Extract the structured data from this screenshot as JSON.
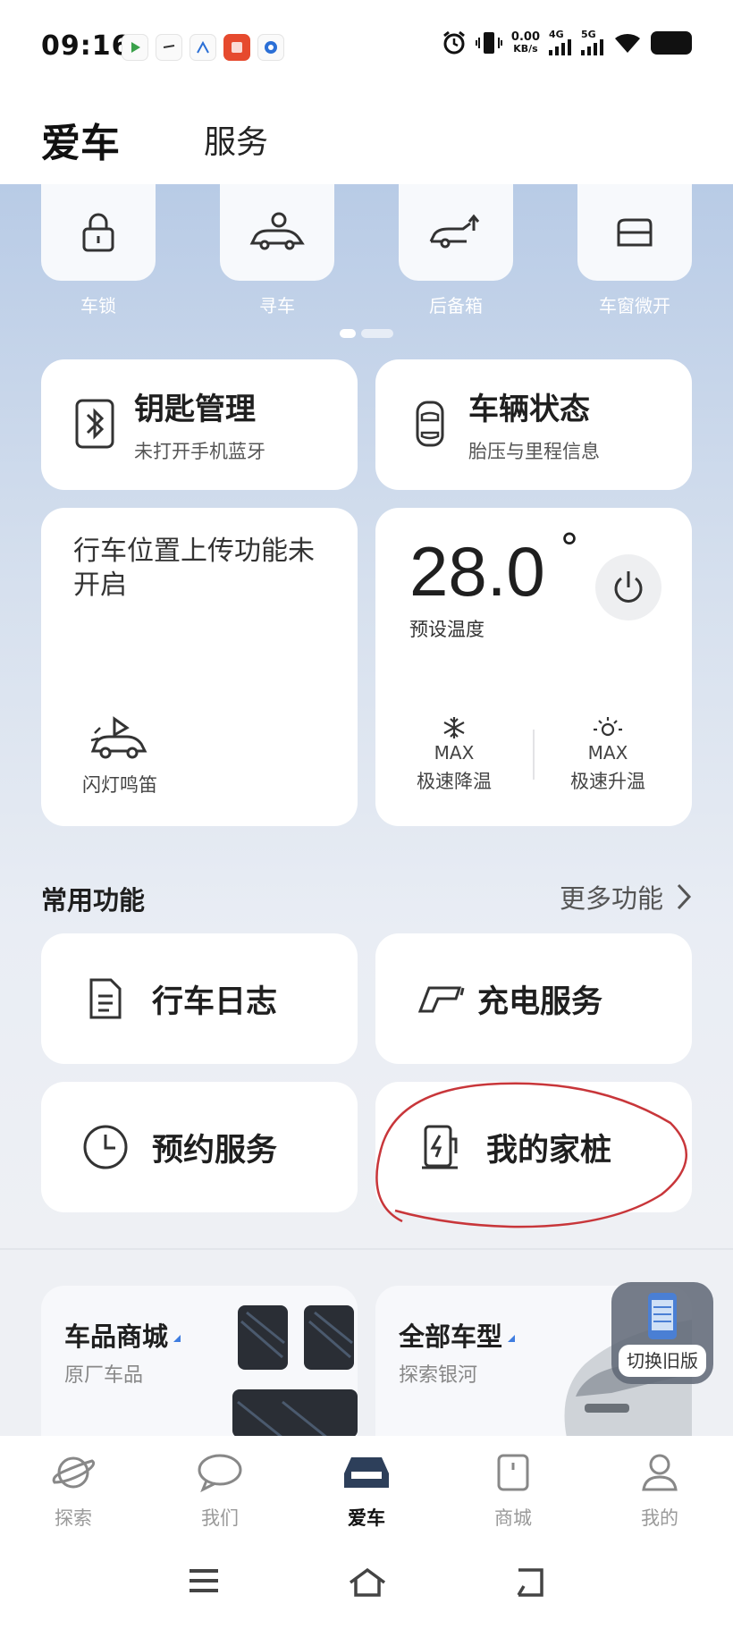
{
  "status_bar": {
    "time": "09:16",
    "net_speed": "0.00",
    "net_unit": "KB/s",
    "net_4g": "4G",
    "net_5g": "5G",
    "app_icons": [
      "video-app-icon",
      "chat-app-icon",
      "car-app-icon",
      "taobao-app-icon",
      "browser-app-icon"
    ]
  },
  "header": {
    "active_tab": "爱车",
    "other_tab": "服务"
  },
  "quick_actions": [
    {
      "label": "车锁",
      "icon": "lock-icon"
    },
    {
      "label": "寻车",
      "icon": "find-car-icon"
    },
    {
      "label": "后备箱",
      "icon": "trunk-icon"
    },
    {
      "label": "车窗微开",
      "icon": "window-icon"
    }
  ],
  "key_card": {
    "title": "钥匙管理",
    "subtitle": "未打开手机蓝牙",
    "icon": "bluetooth-icon"
  },
  "status_card": {
    "title": "车辆状态",
    "subtitle": "胎压与里程信息",
    "icon": "car-top-icon"
  },
  "location_card": {
    "text": "行车位置上传功能未开启",
    "flash_label": "闪灯鸣笛"
  },
  "climate_card": {
    "temperature": "28.0",
    "degree": "°",
    "temp_label": "预设温度",
    "cool_max": "MAX",
    "cool_label": "极速降温",
    "heat_max": "MAX",
    "heat_label": "极速升温"
  },
  "common": {
    "title": "常用功能",
    "more": "更多功能",
    "items": [
      {
        "label": "行车日志",
        "icon": "document-icon"
      },
      {
        "label": "充电服务",
        "icon": "charger-gun-icon"
      },
      {
        "label": "预约服务",
        "icon": "clock-icon"
      },
      {
        "label": "我的家桩",
        "icon": "home-charger-icon"
      }
    ]
  },
  "promos": [
    {
      "title": "车品商城",
      "subtitle": "原厂车品"
    },
    {
      "title": "全部车型",
      "subtitle": "探索银河"
    }
  ],
  "switch_button": {
    "label": "切换旧版"
  },
  "bottom_nav": [
    {
      "label": "探索",
      "icon": "planet-icon"
    },
    {
      "label": "我们",
      "icon": "chat-bubble-icon"
    },
    {
      "label": "爱车",
      "icon": "car-icon",
      "active": true
    },
    {
      "label": "商城",
      "icon": "bag-icon"
    },
    {
      "label": "我的",
      "icon": "profile-icon"
    }
  ],
  "colors": {
    "accent_blue": "#3f7de0",
    "annotation_red": "#c8363a",
    "gradient_top": "#b8cbe6"
  }
}
